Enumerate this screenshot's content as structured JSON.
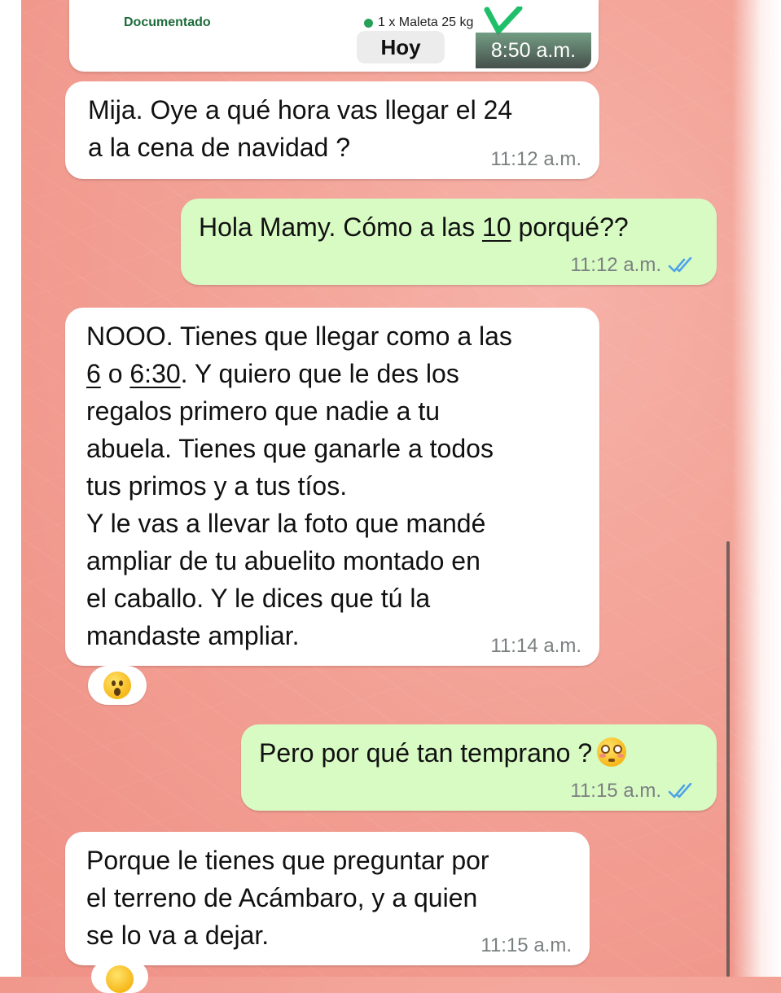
{
  "header_card": {
    "doc_status": "Documentado",
    "baggage": "1 x Maleta 25 kg",
    "day_label": "Hoy",
    "thumb_time": "8:50 a.m."
  },
  "messages": [
    {
      "direction": "incoming",
      "text": "Mija. Oye a qué hora vas llegar el 24\na la cena de navidad ?",
      "time": "11:12 a.m."
    },
    {
      "direction": "outgoing",
      "text_pre": "Hola Mamy. Cómo a las ",
      "text_underlined": "10",
      "text_post": " porqué??",
      "time": "11:12 a.m.",
      "status": "read"
    },
    {
      "direction": "incoming",
      "line1": "NOOO. Tienes que llegar como a las",
      "line2_u1": "6",
      "line2_mid": " o ",
      "line2_u2": "6:30",
      "line2_post": ". Y quiero que le des los",
      "rest": "regalos primero que nadie a tu\nabuela. Tienes que ganarle a todos\ntus primos y a tus tíos.\nY le vas a llevar la foto que mandé\nampliar de tu abuelito montado en\nel caballo. Y le dices que tú la\nmandaste ampliar.",
      "time": "11:14 a.m.",
      "reaction": "astonished-face-emoji"
    },
    {
      "direction": "outgoing",
      "text": "Pero por qué tan temprano ?",
      "emoji": "flushed-face-emoji",
      "time": "11:15 a.m.",
      "status": "read"
    },
    {
      "direction": "incoming",
      "text": "Porque le tienes que preguntar por\nel terreno de Acámbaro, y a quien\nse lo va a dejar.",
      "time": "11:15 a.m."
    }
  ],
  "colors": {
    "background": "#f3a195",
    "incoming_bubble": "#ffffff",
    "outgoing_bubble": "#d8fbc4",
    "read_ticks": "#4fa3e6",
    "meta_text": "#7a7f80"
  }
}
